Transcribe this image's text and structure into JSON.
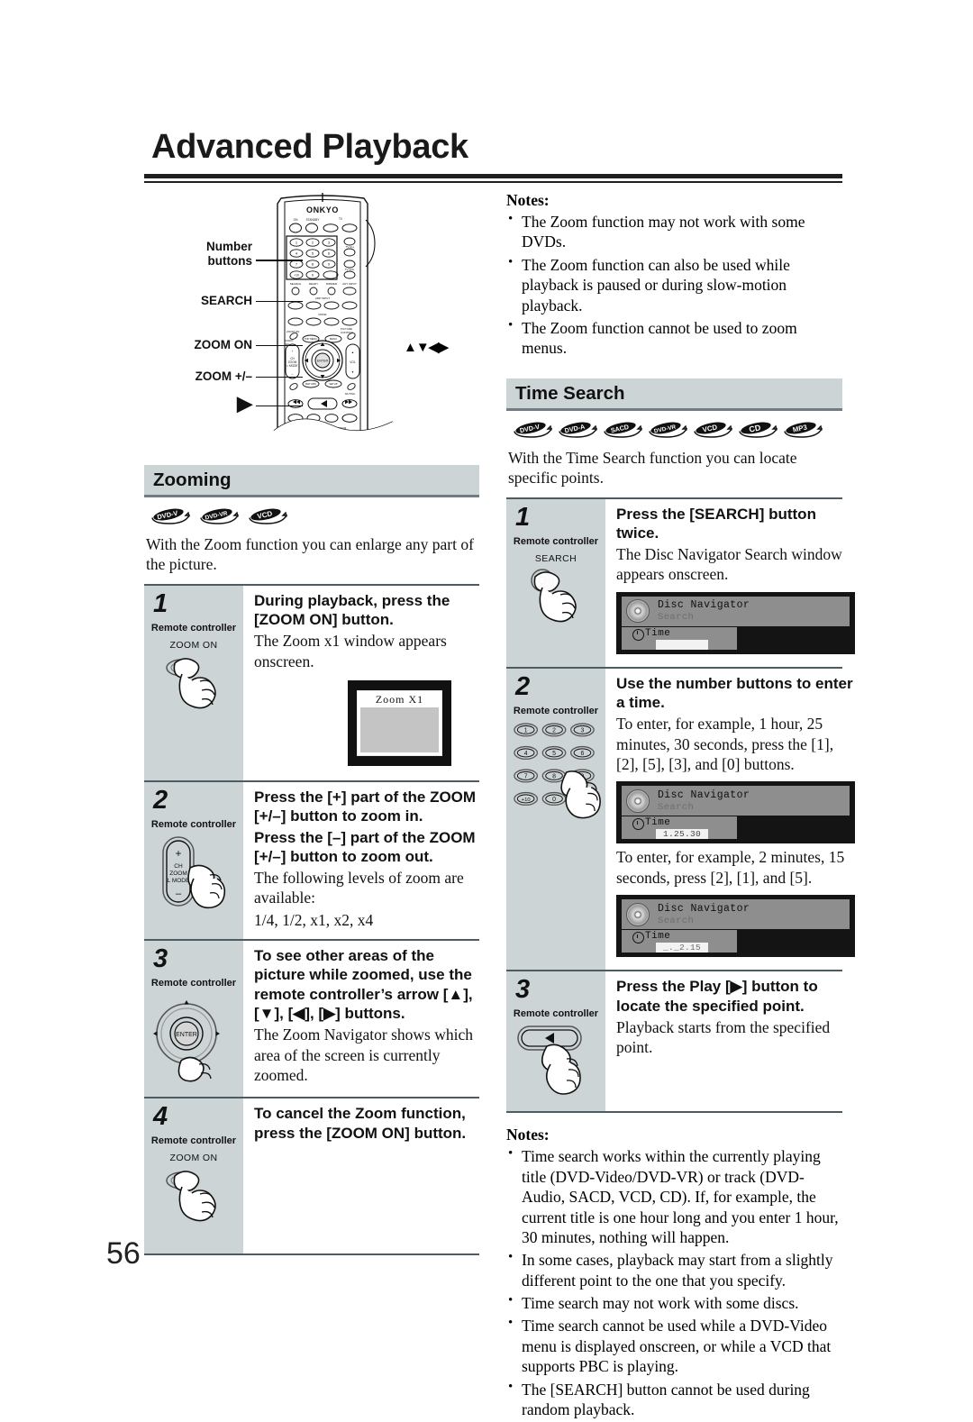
{
  "page": {
    "title": "Advanced Playback",
    "number": "56"
  },
  "remote_figure": {
    "brand": "ONKYO",
    "callouts": {
      "number_buttons_line1": "Number",
      "number_buttons_line2": "buttons",
      "search": "SEARCH",
      "zoom_on": "ZOOM ON",
      "zoom_plus_minus": "ZOOM +/–",
      "play": "▶",
      "arrows": "▲▼◀▶"
    }
  },
  "zoom_notes": {
    "title": "Notes:",
    "items": [
      "The Zoom function may not work with some DVDs.",
      "The Zoom function can also be used while playback is paused or during slow-motion playback.",
      "The Zoom function cannot be used to zoom menus."
    ]
  },
  "zooming_section": {
    "heading": "Zooming",
    "badges": [
      "DVD-V",
      "DVD-VR",
      "VCD"
    ],
    "intro": "With the Zoom function you can enlarge any part of the picture.",
    "steps": [
      {
        "number": "1",
        "device": "Remote controller",
        "button_label": "ZOOM ON",
        "heading": "During playback, press the [ZOOM ON] button.",
        "description": "The Zoom x1 window appears onscreen.",
        "osd": {
          "label": "Zoom  X1"
        }
      },
      {
        "number": "2",
        "device": "Remote controller",
        "button_label": "",
        "rocker": {
          "plus": "+",
          "minus": "–",
          "l1": "CH",
          "l2": "ZOOM",
          "l3": "L MODE"
        },
        "heading_1": "Press the [+] part of the ZOOM [+/–] button to zoom in.",
        "heading_2": "Press the [–] part of the ZOOM [+/–] button to zoom out.",
        "description": "The following levels of zoom are available:",
        "levels": "1/4, 1/2, x1, x2, x4"
      },
      {
        "number": "3",
        "device": "Remote controller",
        "button_label": "ENTER",
        "heading": "To see other areas of the picture while zoomed, use the remote controller’s arrow [▲], [▼], [◀], [▶] buttons.",
        "description": "The Zoom Navigator shows which area of the screen is currently zoomed."
      },
      {
        "number": "4",
        "device": "Remote controller",
        "button_label": "ZOOM ON",
        "heading": "To cancel the Zoom function, press the [ZOOM ON] button.",
        "description": ""
      }
    ]
  },
  "time_search_section": {
    "heading": "Time Search",
    "badges": [
      "DVD-V",
      "DVD-A",
      "SACD",
      "DVD-VR",
      "VCD",
      "CD",
      "MP3"
    ],
    "intro": "With the Time Search function you can locate specific points.",
    "steps": [
      {
        "number": "1",
        "device": "Remote controller",
        "button_label": "SEARCH",
        "heading": "Press the [SEARCH] button twice.",
        "description": "The Disc Navigator Search window appears onscreen.",
        "osd": {
          "title": "Disc Navigator",
          "subtitle": "Search",
          "field": "Time",
          "value": ""
        }
      },
      {
        "number": "2",
        "device": "Remote controller",
        "keypad": [
          "1",
          "2",
          "3",
          "4",
          "5",
          "6",
          "7",
          "8",
          "9",
          "+10",
          "0"
        ],
        "heading": "Use the number buttons to enter a time.",
        "description": "To enter, for example, 1 hour, 25 minutes, 30 seconds, press the [1], [2], [5], [3], and [0] buttons.",
        "osd": {
          "title": "Disc Navigator",
          "subtitle": "Search",
          "field": "Time",
          "value": "1.25.30"
        },
        "description2": "To enter, for example, 2 minutes, 15 seconds, press [2], [1], and [5].",
        "osd2": {
          "title": "Disc Navigator",
          "subtitle": "Search",
          "field": "Time",
          "value": "_._2.15"
        }
      },
      {
        "number": "3",
        "device": "Remote controller",
        "button_label": "▶",
        "heading": "Press the Play [▶] button to locate the specified point.",
        "description": "Playback starts from the specified point."
      }
    ]
  },
  "time_search_notes": {
    "title": "Notes:",
    "items": [
      "Time search works within the currently playing title (DVD-Video/DVD-VR) or track (DVD-Audio, SACD, VCD, CD). If, for example, the current title is one hour long and you enter 1 hour, 30 minutes, nothing will happen.",
      "In some cases, playback may start from a slightly different point to the one that you specify.",
      "Time search may not work with some discs.",
      "Time search cannot be used while a DVD-Video menu is displayed onscreen, or while a VCD that supports PBC is playing.",
      "The [SEARCH] button cannot be used during random playback."
    ]
  },
  "colors": {
    "section_bar": "#ccd4d6",
    "rule": "#6f7d86",
    "osd_dark": "#141414",
    "osd_panel": "#8e8e8e"
  }
}
